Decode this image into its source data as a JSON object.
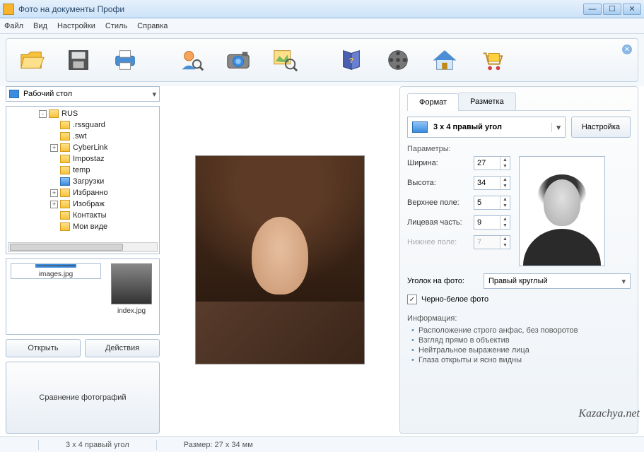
{
  "window": {
    "title": "Фото на документы Профи"
  },
  "menu": {
    "file": "Файл",
    "view": "Вид",
    "settings": "Настройки",
    "style": "Стиль",
    "help": "Справка"
  },
  "pathbox": {
    "label": "Рабочий стол"
  },
  "tree": {
    "items": [
      {
        "label": "RUS",
        "exp": "-",
        "indent": 0
      },
      {
        "label": ".rssguard",
        "exp": "",
        "indent": 1
      },
      {
        "label": ".swt",
        "exp": "",
        "indent": 1
      },
      {
        "label": "CyberLink",
        "exp": "+",
        "indent": 1
      },
      {
        "label": "Impostaz",
        "exp": "",
        "indent": 1
      },
      {
        "label": "temp",
        "exp": "",
        "indent": 1
      },
      {
        "label": "Загрузки",
        "exp": "",
        "indent": 1,
        "blue": true
      },
      {
        "label": "Избранно",
        "exp": "+",
        "indent": 1
      },
      {
        "label": "Изображ",
        "exp": "+",
        "indent": 1
      },
      {
        "label": "Контакты",
        "exp": "",
        "indent": 1
      },
      {
        "label": "Мои виде",
        "exp": "",
        "indent": 1
      }
    ]
  },
  "thumbs": [
    {
      "name": "images.jpg",
      "selected": true
    },
    {
      "name": "index.jpg",
      "selected": false
    }
  ],
  "leftbuttons": {
    "open": "Открыть",
    "actions": "Действия",
    "compare": "Сравнение фотографий"
  },
  "tabs": {
    "format": "Формат",
    "layout": "Разметка"
  },
  "format": {
    "selector_label": "3 x 4 правый угол",
    "config_btn": "Настройка",
    "params_header": "Параметры:",
    "width_label": "Ширина:",
    "width_val": "27",
    "height_label": "Высота:",
    "height_val": "34",
    "top_label": "Верхнее поле:",
    "top_val": "5",
    "face_label": "Лицевая часть:",
    "face_val": "9",
    "bottom_label": "Нижнее поле:",
    "bottom_val": "7",
    "corner_label": "Уголок на фото:",
    "corner_value": "Правый круглый",
    "bw_label": "Черно-белое фото",
    "info_header": "Информация:",
    "info": [
      "Расположение строго анфас, без поворотов",
      "Взгляд прямо в объектив",
      "Нейтральное выражение лица",
      "Глаза открыты и ясно видны"
    ]
  },
  "status": {
    "left": "",
    "format": "3 x 4 правый угол",
    "size": "Размер: 27 x 34 мм"
  },
  "watermark": "Kazachya.net"
}
